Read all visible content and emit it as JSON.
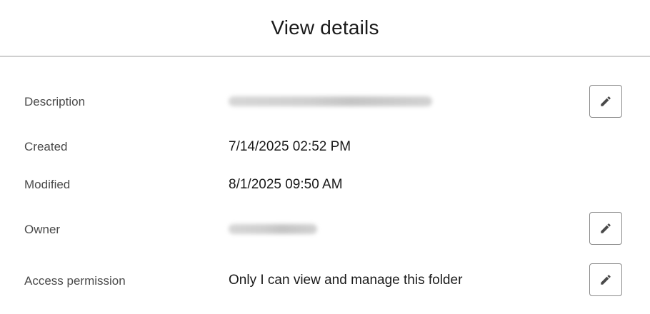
{
  "dialog": {
    "title": "View details"
  },
  "details": {
    "description": {
      "label": "Description"
    },
    "created": {
      "label": "Created",
      "value": "7/14/2025 02:52 PM"
    },
    "modified": {
      "label": "Modified",
      "value": "8/1/2025 09:50 AM"
    },
    "owner": {
      "label": "Owner"
    },
    "access": {
      "label": "Access permission",
      "value": "Only I can view and manage this folder"
    }
  },
  "icons": {
    "edit": "pencil-icon"
  }
}
